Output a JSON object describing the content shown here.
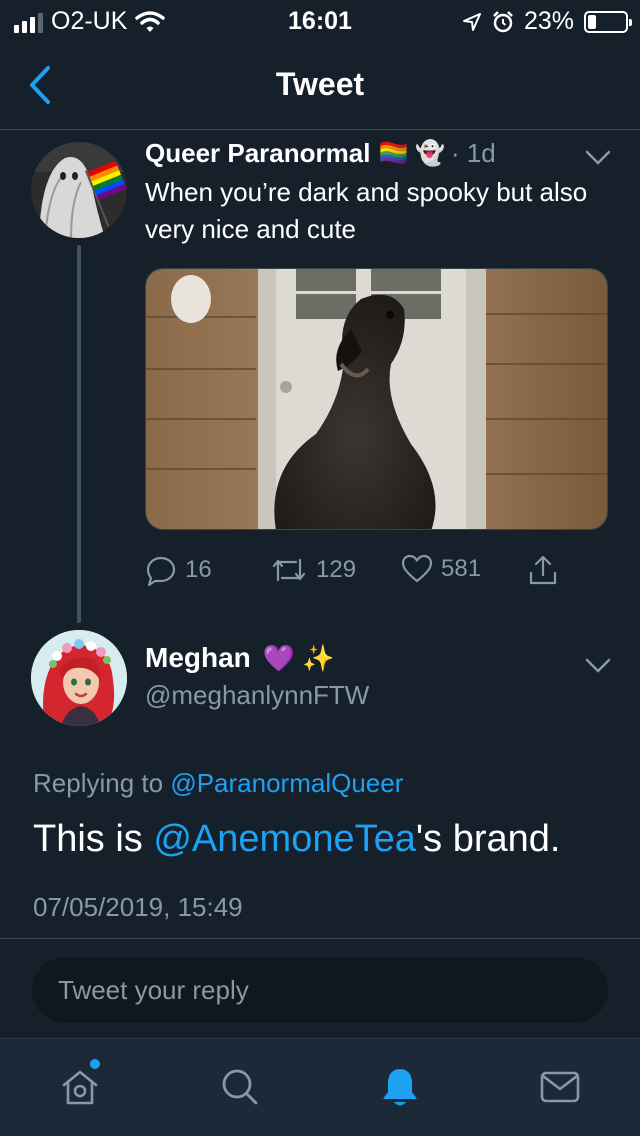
{
  "status_bar": {
    "carrier": "O2-UK",
    "time": "16:01",
    "battery_percent_label": "23%",
    "battery_level": 0.23
  },
  "nav": {
    "title": "Tweet"
  },
  "original_tweet": {
    "author_name": "Queer Paranormal",
    "author_emoji": "🏳️‍🌈 👻",
    "age": "· 1d",
    "text": "When you’re dark and spooky but also very nice and cute",
    "replies": "16",
    "retweets": "129",
    "likes": "581"
  },
  "reply_tweet": {
    "author_name": "Meghan",
    "author_emoji": "💜 ✨",
    "handle": "@meghanlynnFTW",
    "replying_prefix": "Replying to",
    "replying_to": "@ParanormalQueer",
    "text_before": "This is ",
    "mention": "@AnemoneTea",
    "text_after": "'s brand.",
    "timestamp": "07/05/2019, 15:49"
  },
  "reply_box": {
    "placeholder": "Tweet your reply"
  },
  "colors": {
    "background": "#15202b",
    "accent": "#1da1f2",
    "muted": "#8899a6",
    "divider": "#38444d"
  },
  "icons": {
    "tabs": [
      "home-icon",
      "search-icon",
      "notifications-icon",
      "messages-icon"
    ],
    "actions": [
      "reply-icon",
      "retweet-icon",
      "like-icon",
      "share-icon"
    ]
  }
}
